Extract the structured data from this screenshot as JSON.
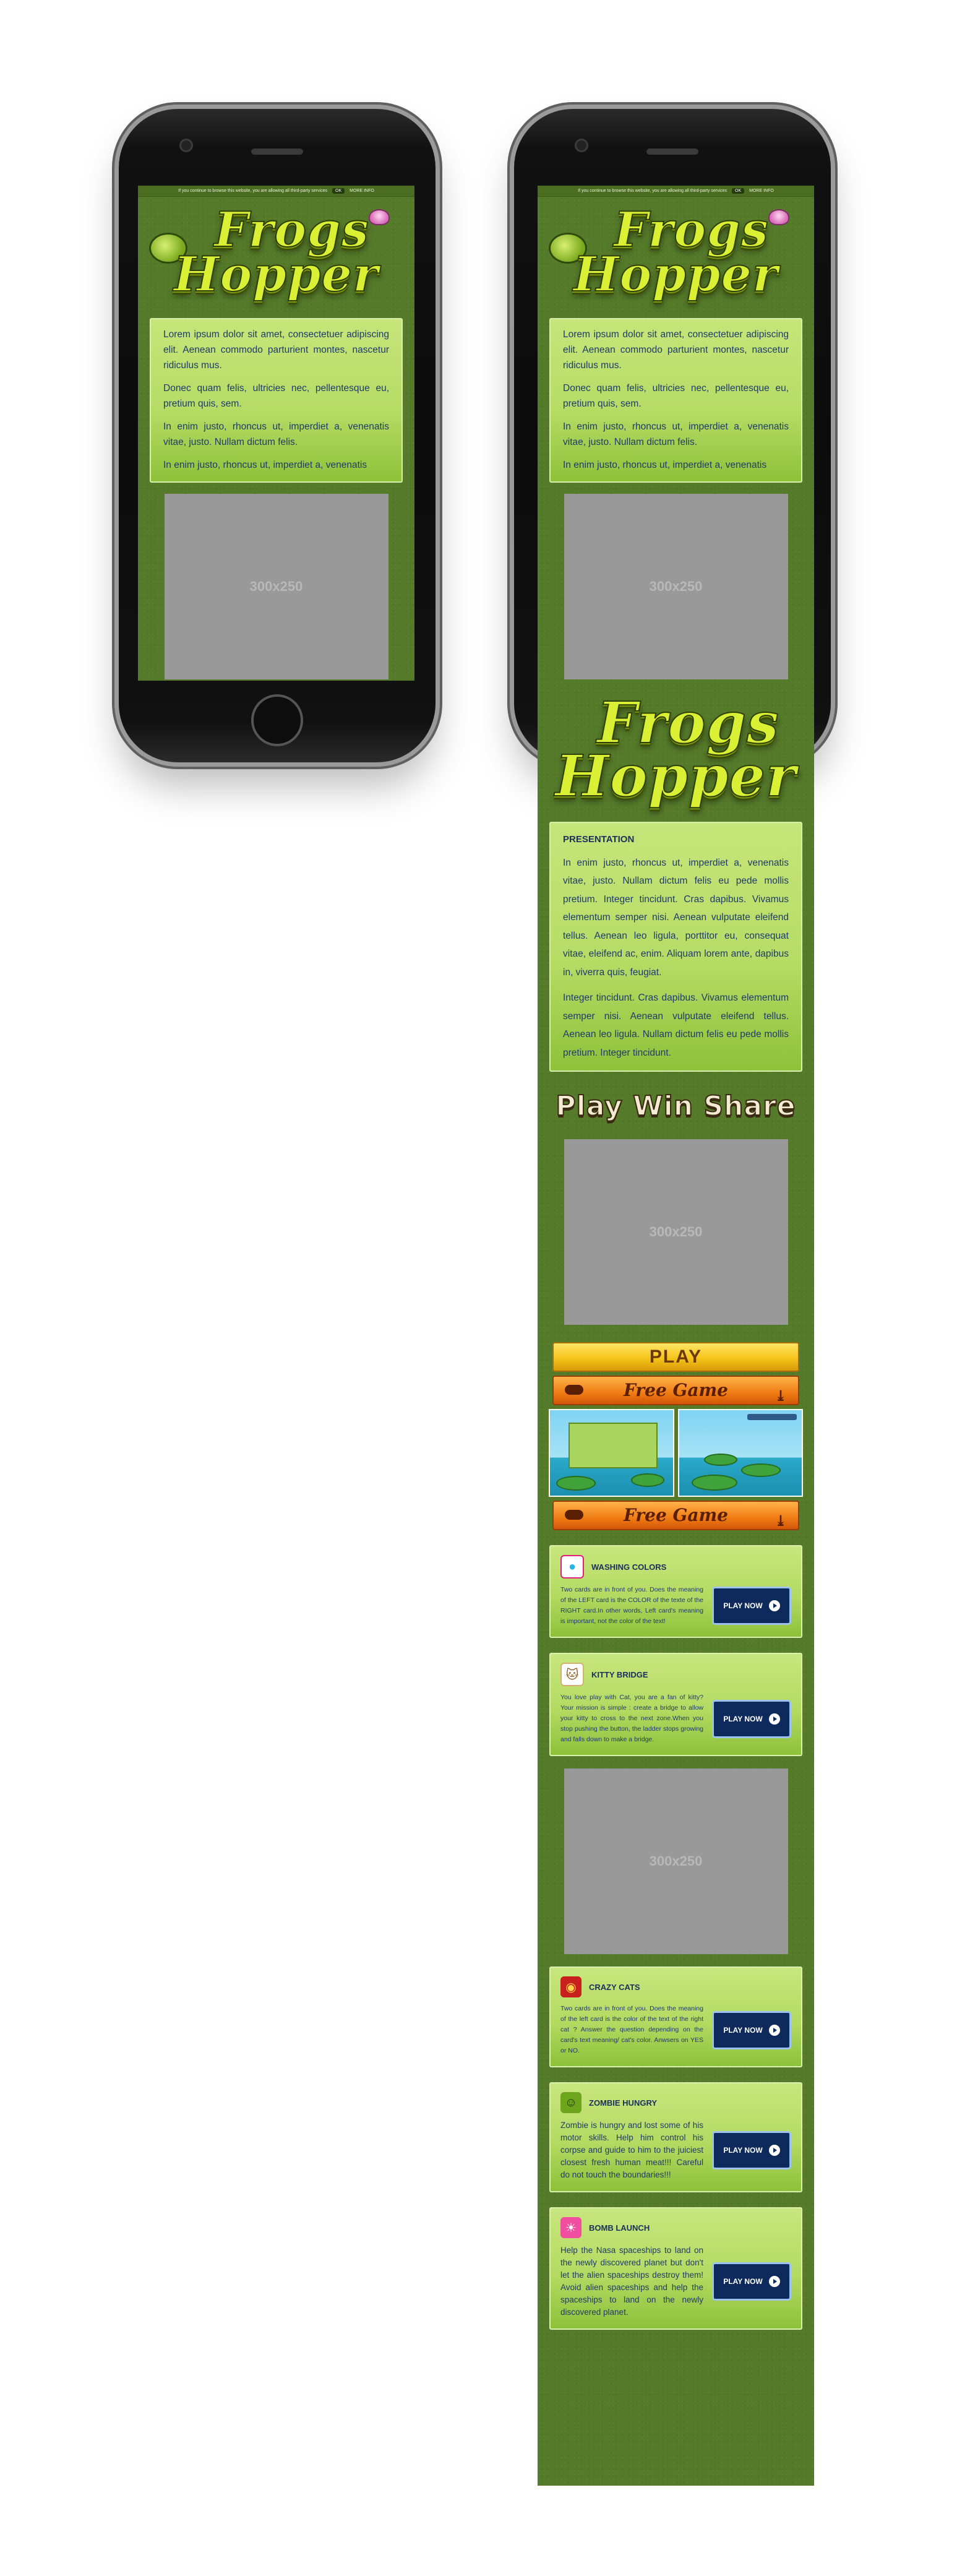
{
  "cookie": {
    "text": "If you continue to browse this website, you are allowing all third-party services",
    "ok": "OK",
    "more": "MORE INFO"
  },
  "logo": {
    "line1": "Frogs",
    "line2": "Hopper"
  },
  "intro": {
    "p1": "Lorem ipsum dolor sit amet, consectetuer adipiscing elit. Aenean commodo parturient montes, nascetur ridiculus mus.",
    "p2": "Donec quam felis, ultricies nec, pellentesque eu, pretium quis, sem.",
    "p3": "In enim justo, rhoncus ut, imperdiet a, venenatis vitae, justo. Nullam dictum felis.",
    "p4": "In enim justo, rhoncus ut, imperdiet a, venenatis"
  },
  "ad_label": "300x250",
  "presentation": {
    "heading": "PRESENTATION",
    "p1": "In enim justo, rhoncus ut, imperdiet a, venenatis vitae, justo. Nullam dictum felis eu pede mollis pretium. Integer tincidunt. Cras dapibus. Vivamus elementum semper nisi. Aenean vulputate eleifend tellus. Aenean leo ligula, porttitor eu, consequat vitae, eleifend ac, enim. Aliquam lorem ante, dapibus in, viverra quis, feugiat.",
    "p2": "Integer tincidunt. Cras dapibus. Vivamus elementum semper nisi. Aenean vulputate eleifend tellus. Aenean leo ligula. Nullam dictum felis eu pede mollis pretium. Integer tincidunt."
  },
  "tagline": "Play Win Share",
  "buttons": {
    "play": "PLAY",
    "free_game": "Free Game",
    "play_now": "PLAY NOW"
  },
  "games": [
    {
      "title": "WASHING COLORS",
      "icon": "washing-colors-icon",
      "desc": "Two cards are in front of you. Does the meaning of the LEFT card is the COLOR of the texte of the RIGHT card.In other words, Left card's meaning is important, not the color of the text!"
    },
    {
      "title": "KITTY BRIDGE",
      "icon": "kitty-bridge-icon",
      "desc": "You love play with Cat, you are a fan of kitty? Your mission is simple : create a bridge to allow your kitty to cross to the next zone.When you stop pushing the button, the ladder stops growing and falls down to make a bridge."
    },
    {
      "title": "CRAZY CATS",
      "icon": "crazy-cats-icon",
      "desc": "Two cards are in front of you. Does the meaning of the left card is the color of the text of the right cat ? Answer the question depending on the card's text meaning/ cat's color. Anwsers on YES or NO."
    },
    {
      "title": "ZOMBIE HUNGRY",
      "icon": "zombie-hungry-icon",
      "desc": "Zombie is hungry and lost some of his motor skills. Help him control his corpse and guide to him to the juiciest closest fresh human meat!!! Careful do not touch the boundaries!!!"
    },
    {
      "title": "BOMB LAUNCH",
      "icon": "bomb-launch-icon",
      "desc": "Help the Nasa spaceships to land on the newly discovered planet but don't let the alien spaceships destroy them! Avoid alien spaceships and help the spaceships to land on the newly discovered planet."
    }
  ],
  "colors": {
    "background": "#557a29",
    "card": "#b7dc66",
    "button_dark": "#0e2a5c",
    "play": "#f5c41a",
    "free": "#f07c14"
  }
}
